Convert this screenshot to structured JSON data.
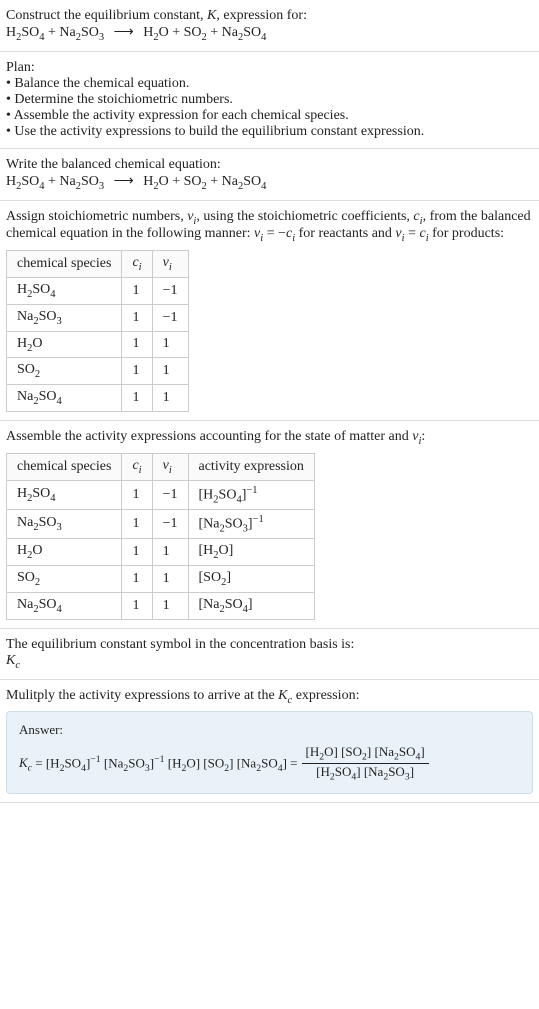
{
  "header": {
    "prompt": "Construct the equilibrium constant, ",
    "kvar": "K",
    "prompt2": ", expression for:"
  },
  "equation_unbalanced_html": "H<sub>2</sub>SO<sub>4</sub> + Na<sub>2</sub>SO<sub>3</sub> <span class='arrow'>⟶</span> H<sub>2</sub>O + SO<sub>2</sub> + Na<sub>2</sub>SO<sub>4</sub>",
  "plan": {
    "title": "Plan:",
    "items": [
      "Balance the chemical equation.",
      "Determine the stoichiometric numbers.",
      "Assemble the activity expression for each chemical species.",
      "Use the activity expressions to build the equilibrium constant expression."
    ]
  },
  "balanced": {
    "title": "Write the balanced chemical equation:",
    "equation_html": "H<sub>2</sub>SO<sub>4</sub> + Na<sub>2</sub>SO<sub>3</sub> <span class='arrow'>⟶</span> H<sub>2</sub>O + SO<sub>2</sub> + Na<sub>2</sub>SO<sub>4</sub>"
  },
  "stoich": {
    "intro_html": "Assign stoichiometric numbers, <span class='ital'>ν<sub>i</sub></span>, using the stoichiometric coefficients, <span class='ital'>c<sub>i</sub></span>, from the balanced chemical equation in the following manner: <span class='ital'>ν<sub>i</sub></span> = −<span class='ital'>c<sub>i</sub></span> for reactants and <span class='ital'>ν<sub>i</sub></span> = <span class='ital'>c<sub>i</sub></span> for products:",
    "headers": {
      "species": "chemical species",
      "ci_html": "<span class='ital'>c<sub>i</sub></span>",
      "vi_html": "<span class='ital'>ν<sub>i</sub></span>"
    },
    "rows": [
      {
        "species_html": "H<sub>2</sub>SO<sub>4</sub>",
        "ci": "1",
        "vi": "−1"
      },
      {
        "species_html": "Na<sub>2</sub>SO<sub>3</sub>",
        "ci": "1",
        "vi": "−1"
      },
      {
        "species_html": "H<sub>2</sub>O",
        "ci": "1",
        "vi": "1"
      },
      {
        "species_html": "SO<sub>2</sub>",
        "ci": "1",
        "vi": "1"
      },
      {
        "species_html": "Na<sub>2</sub>SO<sub>4</sub>",
        "ci": "1",
        "vi": "1"
      }
    ]
  },
  "activity": {
    "intro_html": "Assemble the activity expressions accounting for the state of matter and <span class='ital'>ν<sub>i</sub></span>:",
    "headers": {
      "species": "chemical species",
      "ci_html": "<span class='ital'>c<sub>i</sub></span>",
      "vi_html": "<span class='ital'>ν<sub>i</sub></span>",
      "act": "activity expression"
    },
    "rows": [
      {
        "species_html": "H<sub>2</sub>SO<sub>4</sub>",
        "ci": "1",
        "vi": "−1",
        "act_html": "[H<sub>2</sub>SO<sub>4</sub>]<sup>−1</sup>"
      },
      {
        "species_html": "Na<sub>2</sub>SO<sub>3</sub>",
        "ci": "1",
        "vi": "−1",
        "act_html": "[Na<sub>2</sub>SO<sub>3</sub>]<sup>−1</sup>"
      },
      {
        "species_html": "H<sub>2</sub>O",
        "ci": "1",
        "vi": "1",
        "act_html": "[H<sub>2</sub>O]"
      },
      {
        "species_html": "SO<sub>2</sub>",
        "ci": "1",
        "vi": "1",
        "act_html": "[SO<sub>2</sub>]"
      },
      {
        "species_html": "Na<sub>2</sub>SO<sub>4</sub>",
        "ci": "1",
        "vi": "1",
        "act_html": "[Na<sub>2</sub>SO<sub>4</sub>]"
      }
    ]
  },
  "kc_symbol": {
    "line1": "The equilibrium constant symbol in the concentration basis is:",
    "sym_html": "<span class='ital'>K<sub>c</sub></span>"
  },
  "multiply": {
    "intro_html": "Mulitply the activity expressions to arrive at the <span class='ital'>K<sub>c</sub></span> expression:"
  },
  "answer": {
    "label": "Answer:",
    "lhs_html": "<span class='ital'>K<sub>c</sub></span> = [H<sub>2</sub>SO<sub>4</sub>]<sup>−1</sup> [Na<sub>2</sub>SO<sub>3</sub>]<sup>−1</sup> [H<sub>2</sub>O] [SO<sub>2</sub>] [Na<sub>2</sub>SO<sub>4</sub>] = ",
    "frac_num_html": "[H<sub>2</sub>O] [SO<sub>2</sub>] [Na<sub>2</sub>SO<sub>4</sub>]",
    "frac_den_html": "[H<sub>2</sub>SO<sub>4</sub>] [Na<sub>2</sub>SO<sub>3</sub>]"
  }
}
